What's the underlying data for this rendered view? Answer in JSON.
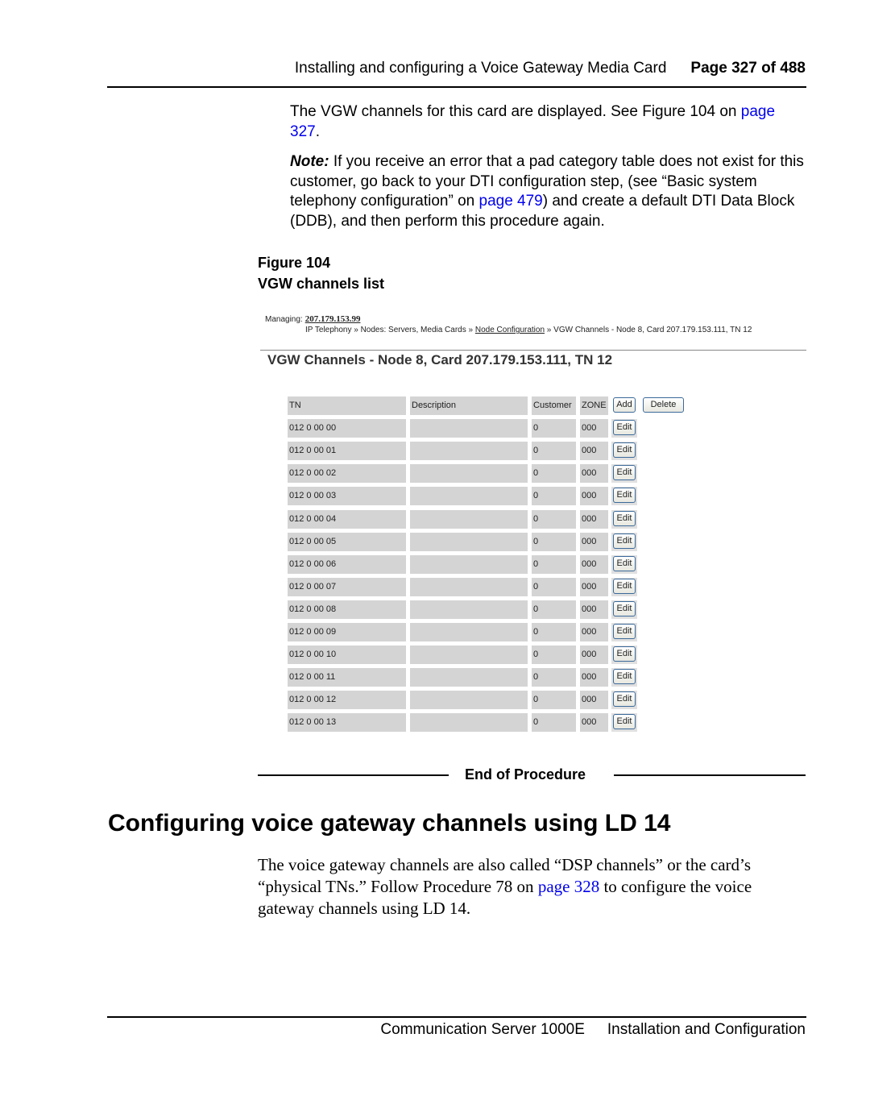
{
  "header": {
    "chapter": "Installing and configuring a Voice Gateway Media Card",
    "page": "Page 327 of 488"
  },
  "para1": {
    "text": "The VGW channels for this card are displayed. See Figure 104 on ",
    "link": "page 327",
    "tail": "."
  },
  "note": {
    "label": "Note:",
    "text1": "  If you receive an error that a pad category table does not exist for this customer, go back to your DTI configuration step, (see “Basic system telephony configuration” on ",
    "link": "page 479",
    "text2": ") and create a default DTI Data Block (DDB), and then perform this procedure again."
  },
  "figure": {
    "number": "Figure 104",
    "title": "VGW channels list",
    "managing_label": "Managing:",
    "managing_ip": "207.179.153.99",
    "breadcrumb": {
      "part1": "IP Telephony » Nodes: Servers, Media Cards » ",
      "link": "Node Configuration",
      "part2": " » VGW Channels - Node 8, Card 207.179.153.111, TN 12"
    },
    "page_title": "VGW Channels - Node 8, Card 207.179.153.111, TN 12",
    "columns": [
      "TN",
      "Description",
      "Customer",
      "ZONE"
    ],
    "add_label": "Add",
    "delete_label": "Delete",
    "edit_label": "Edit",
    "rows": [
      {
        "tn": "012 0 00 00",
        "description": "",
        "customer": "0",
        "zone": "000"
      },
      {
        "tn": "012 0 00 01",
        "description": "",
        "customer": "0",
        "zone": "000"
      },
      {
        "tn": "012 0 00 02",
        "description": "",
        "customer": "0",
        "zone": "000"
      },
      {
        "tn": "012 0 00 03",
        "description": "",
        "customer": "0",
        "zone": "000"
      },
      {
        "tn": "012 0 00 04",
        "description": "",
        "customer": "0",
        "zone": "000"
      },
      {
        "tn": "012 0 00 05",
        "description": "",
        "customer": "0",
        "zone": "000"
      },
      {
        "tn": "012 0 00 06",
        "description": "",
        "customer": "0",
        "zone": "000"
      },
      {
        "tn": "012 0 00 07",
        "description": "",
        "customer": "0",
        "zone": "000"
      },
      {
        "tn": "012 0 00 08",
        "description": "",
        "customer": "0",
        "zone": "000"
      },
      {
        "tn": "012 0 00 09",
        "description": "",
        "customer": "0",
        "zone": "000"
      },
      {
        "tn": "012 0 00 10",
        "description": "",
        "customer": "0",
        "zone": "000"
      },
      {
        "tn": "012 0 00 11",
        "description": "",
        "customer": "0",
        "zone": "000"
      },
      {
        "tn": "012 0 00 12",
        "description": "",
        "customer": "0",
        "zone": "000"
      },
      {
        "tn": "012 0 00 13",
        "description": "",
        "customer": "0",
        "zone": "000"
      }
    ]
  },
  "end_of_procedure": "End of Procedure",
  "section": {
    "heading": "Configuring voice gateway channels using LD 14",
    "text1": "The voice gateway channels are also called “DSP channels” or the card’s “physical TNs.” Follow Procedure 78 on ",
    "link": "page 328",
    "text2": " to configure the voice gateway channels using LD 14."
  },
  "footer": {
    "product": "Communication Server 1000E",
    "doc": "Installation and Configuration"
  }
}
